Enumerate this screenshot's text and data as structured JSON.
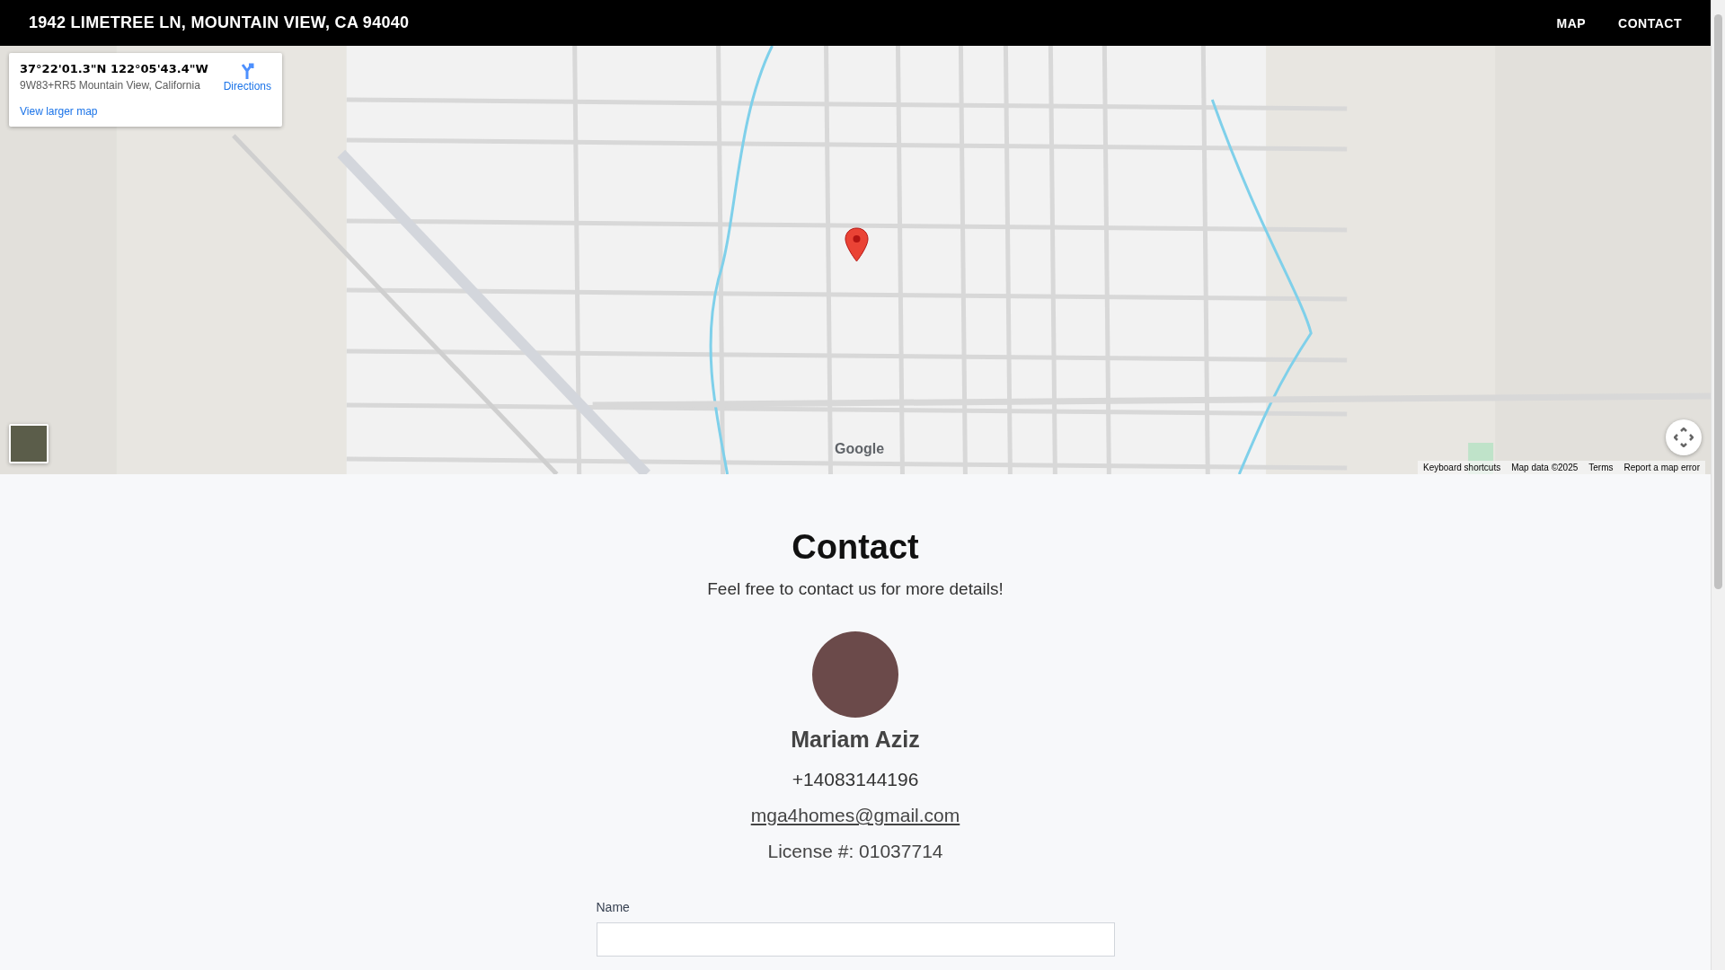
{
  "header": {
    "title": "1942 LIMETREE LN, MOUNTAIN VIEW, CA 94040",
    "nav": [
      {
        "label": "MAP"
      },
      {
        "label": "CONTACT"
      }
    ]
  },
  "map": {
    "card": {
      "coordinates": "37°22'01.3\"N 122°05'43.4\"W",
      "plus_code": "9W83+RR5 Mountain View, California",
      "directions": "Directions",
      "larger_map_link": "View larger map"
    },
    "logo": "Google",
    "attribution": [
      "Keyboard shortcuts",
      "Map data ©2025",
      "Terms",
      "Report a map error"
    ]
  },
  "contact": {
    "title": "Contact",
    "subtitle": "Feel free to contact us for more details!",
    "agent": {
      "name": "Mariam Aziz",
      "phone": "+14083144196",
      "email": "mga4homes@gmail.com",
      "license": "License #: 01037714"
    },
    "form": {
      "fields": [
        {
          "label": "Name"
        }
      ]
    }
  }
}
